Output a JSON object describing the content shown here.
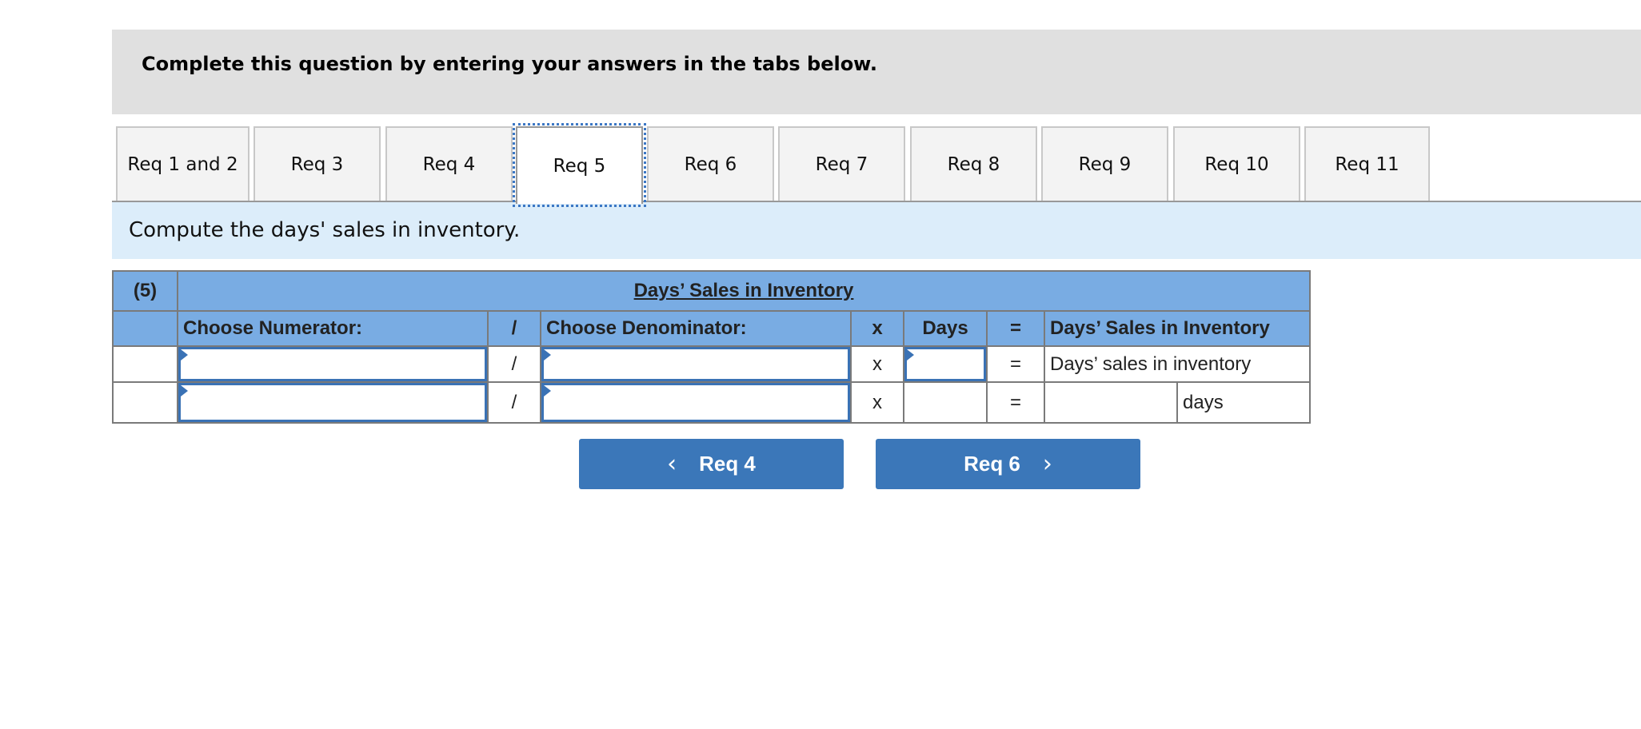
{
  "banner": {
    "text": "Complete this question by entering your answers in the tabs below."
  },
  "tabs": [
    {
      "label": "Req 1 and 2",
      "active": false
    },
    {
      "label": "Req 3",
      "active": false
    },
    {
      "label": "Req 4",
      "active": false
    },
    {
      "label": "Req 5",
      "active": true
    },
    {
      "label": "Req 6",
      "active": false
    },
    {
      "label": "Req 7",
      "active": false
    },
    {
      "label": "Req 8",
      "active": false
    },
    {
      "label": "Req 9",
      "active": false
    },
    {
      "label": "Req 10",
      "active": false
    },
    {
      "label": "Req 11",
      "active": false
    }
  ],
  "instruction": "Compute the days' sales in inventory.",
  "table": {
    "part_label": "(5)",
    "title": "Days’ Sales in Inventory",
    "headers": {
      "numerator": "Choose Numerator:",
      "divide": "/",
      "denominator": "Choose Denominator:",
      "times": "x",
      "days": "Days",
      "equals": "=",
      "result": "Days’ Sales in Inventory"
    },
    "row1": {
      "numerator_value": "",
      "divide": "/",
      "denominator_value": "",
      "times": "x",
      "days_value": "",
      "equals": "=",
      "result_label": "Days’ sales in inventory"
    },
    "row2": {
      "numerator_value": "",
      "divide": "/",
      "denominator_value": "",
      "times": "x",
      "days_value": "",
      "equals": "=",
      "result_value": "",
      "result_unit": "days"
    }
  },
  "nav": {
    "prev_label": "Req 4",
    "next_label": "Req 6",
    "prev_icon": "chevron-left-icon",
    "next_icon": "chevron-right-icon"
  },
  "colors": {
    "banner_bg": "#e0e0e0",
    "instruction_bg": "#dcedfa",
    "table_header_bg": "#79ace3",
    "button_bg": "#3b77b9",
    "input_border": "#3a72b5"
  }
}
